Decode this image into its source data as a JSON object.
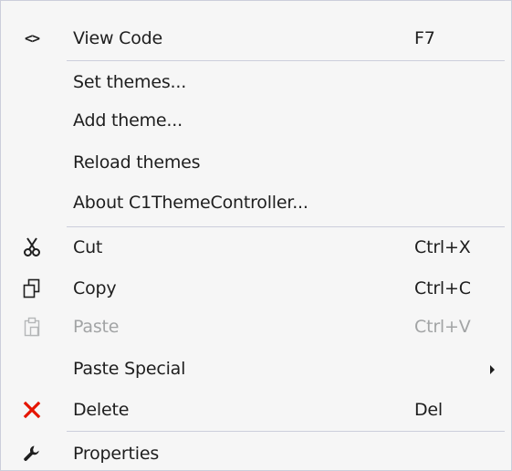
{
  "menu": {
    "items": [
      {
        "label": "View Code",
        "shortcut": "F7",
        "icon": "code-brackets-icon",
        "icon_text": "<>"
      },
      {
        "label": "Set themes...",
        "shortcut": ""
      },
      {
        "label": "Add theme...",
        "shortcut": ""
      },
      {
        "label": "Reload themes",
        "shortcut": ""
      },
      {
        "label": "About C1ThemeController...",
        "shortcut": ""
      },
      {
        "label": "Cut",
        "shortcut": "Ctrl+X",
        "icon": "scissors-icon"
      },
      {
        "label": "Copy",
        "shortcut": "Ctrl+C",
        "icon": "copy-icon"
      },
      {
        "label": "Paste",
        "shortcut": "Ctrl+V",
        "icon": "paste-icon",
        "disabled": true
      },
      {
        "label": "Paste Special",
        "shortcut": "",
        "submenu": true
      },
      {
        "label": "Delete",
        "shortcut": "Del",
        "icon": "delete-x-icon"
      },
      {
        "label": "Properties",
        "shortcut": "",
        "icon": "wrench-icon"
      }
    ]
  },
  "colors": {
    "background": "#f6f6f6",
    "text": "#1e1e1e",
    "disabled_text": "#a2a4a5",
    "separator": "#cccedb",
    "delete_icon": "#e51400"
  }
}
